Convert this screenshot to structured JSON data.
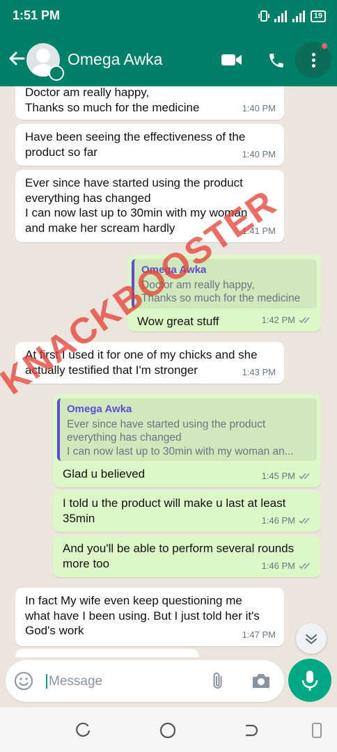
{
  "status": {
    "time": "1:51 PM",
    "battery": "19"
  },
  "contact": {
    "name": "Omega Awka"
  },
  "colors": {
    "header": "#008069",
    "outgoing": "#dcf8c6",
    "incoming": "#ffffff",
    "quote_accent": "#5e4bd6",
    "accent": "#00a884"
  },
  "messages": [
    {
      "text": "Doctor am really happy,\nThanks so much for the medicine",
      "time": "1:40 PM"
    },
    {
      "text": "Have been seeing the effectiveness of the\nproduct so far",
      "time": "1:40 PM"
    },
    {
      "text": "Ever since have started using the product\neverything has changed\nI can now last up to 30min with my woman\nand make her scream hardly",
      "time": "1:41 PM"
    },
    {
      "quote_name": "Omega Awka",
      "quote_text": "Doctor am really happy,\nThanks so much for the medicine",
      "text": "Wow great stuff",
      "time": "1:42 PM"
    },
    {
      "text": "At first I used it for one of my chicks and she\nactually testified that I'm stronger",
      "time": "1:43 PM"
    },
    {
      "quote_name": "Omega Awka",
      "quote_text": "Ever since have started using the product\neverything has changed\nI can now last up to 30min with my woman an...",
      "text": "Glad u believed",
      "time": "1:45 PM"
    },
    {
      "text": "I told u the product will make u last at least\n35min",
      "time": "1:46 PM"
    },
    {
      "text": "And you'll be able to perform several rounds\nmore too",
      "time": "1:46 PM"
    },
    {
      "text": "In fact My wife even keep questioning me\nwhat have I been using. But I just told her it's\nGod's work",
      "time": "1:47 PM"
    }
  ],
  "watermark": "KNACKBOOSTER",
  "composer": {
    "placeholder": "Message"
  }
}
